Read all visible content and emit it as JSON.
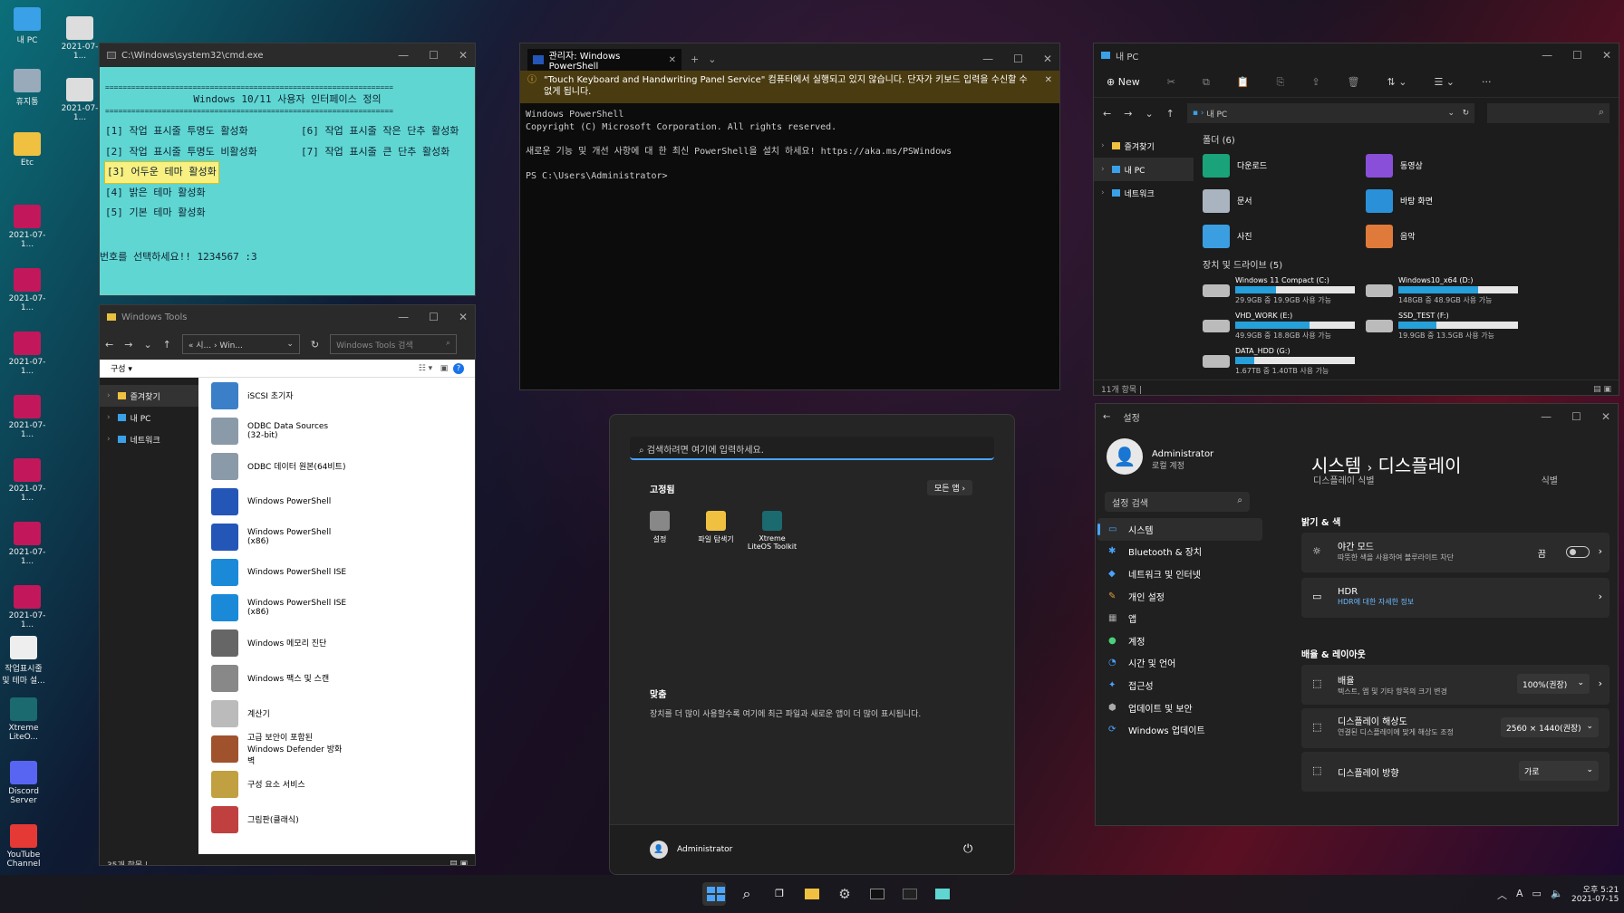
{
  "desktop": {
    "icons": [
      {
        "label": "내 PC",
        "color": "#3aa0e8"
      },
      {
        "label": "2021-07-1...",
        "color": "#ddd"
      },
      {
        "label": "휴지통",
        "color": "#9ab"
      },
      {
        "label": "2021-07-1...",
        "color": "#ddd"
      },
      {
        "label": "Etc",
        "color": "#f0c040"
      },
      {
        "label": "2021-07-1...",
        "color": "#c2185b"
      },
      {
        "label": "2021-07-1...",
        "color": "#c2185b"
      },
      {
        "label": "2021-07-1...",
        "color": "#c2185b"
      },
      {
        "label": "2021-07-1...",
        "color": "#c2185b"
      },
      {
        "label": "2021-07-1...",
        "color": "#c2185b"
      },
      {
        "label": "2021-07-1...",
        "color": "#c2185b"
      },
      {
        "label": "2021-07-1...",
        "color": "#c2185b"
      },
      {
        "label": "작업표시줄 및 테마 설...",
        "color": "#eee"
      },
      {
        "label": "Xtreme LiteO...",
        "color": "#1a6a70"
      },
      {
        "label": "Discord Server",
        "color": "#5865f2"
      },
      {
        "label": "YouTube Channel",
        "color": "#e53935"
      }
    ]
  },
  "cmd": {
    "title": "C:\\Windows\\system32\\cmd.exe",
    "rule": "==================================================================",
    "heading": "Windows 10/11 사용자 인터페이스 정의",
    "left": [
      "[1] 작업 표시줄 투명도 활성화",
      "[2] 작업 표시줄 투명도 비활성화",
      "[3] 어두운 테마 활성화",
      "[4] 밝은 테마 활성화",
      "[5] 기본 테마 활성화"
    ],
    "right": [
      "[6] 작업 표시줄 작은 단추 활성화",
      "[7] 작업 표시줄 큰 단추 활성화"
    ],
    "prompt": "번호를 선택하세요!! 1234567 :3"
  },
  "tools": {
    "title": "Windows Tools",
    "path": "« 시... › Win...",
    "search": "Windows Tools 검색",
    "menu": "구성 ▾",
    "nav": [
      "즐겨찾기",
      "내 PC",
      "네트워크"
    ],
    "items": [
      "iSCSI 초기자",
      "ODBC Data Sources (32-bit)",
      "ODBC 데이터 원본(64비트)",
      "Windows PowerShell",
      "Windows PowerShell (x86)",
      "Windows PowerShell ISE",
      "Windows PowerShell ISE (x86)",
      "Windows 메모리 진단",
      "Windows 팩스 및 스캔",
      "계산기",
      "고급 보안이 포함된 Windows Defender 방화벽",
      "구성 요소 서비스",
      "그림판(클래식)"
    ],
    "status": "35개 항목  |"
  },
  "ps": {
    "tab": "관리자: Windows PowerShell",
    "warn": "\"Touch Keyboard and Handwriting Panel Service\" 컴퓨터에서 실행되고 있지 않습니다. 단자가 키보드 입력을 수신할 수 없게 됩니다.",
    "lines": [
      "Windows PowerShell",
      "Copyright (C) Microsoft Corporation. All rights reserved.",
      "",
      "새로운 기능 및 개선 사항에 대 한 최신 PowerShell을 설치 하세요! https://aka.ms/PSWindows",
      "",
      "PS C:\\Users\\Administrator>"
    ]
  },
  "explorer": {
    "title": "내 PC",
    "new": "New",
    "address": "내 PC",
    "nav": [
      "즐겨찾기",
      "내 PC",
      "네트워크"
    ],
    "folders_header": "폴더 (6)",
    "folders": [
      {
        "name": "다운로드",
        "color": "#1aa37a"
      },
      {
        "name": "동영상",
        "color": "#8a4fd8"
      },
      {
        "name": "문서",
        "color": "#aab4c0"
      },
      {
        "name": "바탕 화면",
        "color": "#2a90d8"
      },
      {
        "name": "사진",
        "color": "#3a9ee0"
      },
      {
        "name": "음악",
        "color": "#e07a3a"
      }
    ],
    "drives_header": "장치 및 드라이브 (5)",
    "drives": [
      {
        "name": "Windows 11 Compact (C:)",
        "free": "29.9GB 중 19.9GB 사용 가능",
        "used": 0.34
      },
      {
        "name": "Windows10_x64 (D:)",
        "free": "148GB 중 48.9GB 사용 가능",
        "used": 0.67
      },
      {
        "name": "VHD_WORK (E:)",
        "free": "49.9GB 중 18.8GB 사용 가능",
        "used": 0.62
      },
      {
        "name": "SSD_TEST (F:)",
        "free": "19.9GB 중 13.5GB 사용 가능",
        "used": 0.32
      },
      {
        "name": "DATA_HDD (G:)",
        "free": "1.67TB 중 1.40TB 사용 가능",
        "used": 0.16
      }
    ],
    "status": "11개 항목  |"
  },
  "settings": {
    "title": "설정",
    "user": "Administrator",
    "account": "로컬 계정",
    "search": "설정 검색",
    "crumb1": "시스템",
    "crumb2": "디스플레이",
    "partial_left": "디스플레이 식별",
    "partial_right": "식별",
    "nav": [
      "시스템",
      "Bluetooth & 장치",
      "네트워크 및 인터넷",
      "개인 설정",
      "앱",
      "계정",
      "시간 및 언어",
      "접근성",
      "업데이트 및 보안",
      "Windows 업데이트"
    ],
    "sec1": "밝기 & 색",
    "night": "야간 모드",
    "night_sub": "따뜻한 색을 사용하여 블루라이트 차단",
    "night_state": "끔",
    "hdr": "HDR",
    "hdr_sub": "HDR에 대한 자세한 정보",
    "sec2": "배율 & 레이아웃",
    "scale": "배율",
    "scale_sub": "텍스트, 앱 및 기타 항목의 크기 변경",
    "scale_val": "100%(권장)",
    "res": "디스플레이 해상도",
    "res_sub": "연결된 디스플레이에 맞게 해상도 조정",
    "res_val": "2560 × 1440(권장)",
    "orient": "디스플레이 방향",
    "orient_val": "가로"
  },
  "start": {
    "search": "검색하려면 여기에 입력하세요.",
    "pinned": "고정됨",
    "all": "모든 앱  ›",
    "apps": [
      "설정",
      "파일 탐색기",
      "Xtreme LiteOS Toolkit"
    ],
    "rec": "맞춤",
    "rec_sub": "장치를 더 많이 사용할수록 여기에 최근 파일과 새로운 앱이 더 많이 표시됩니다.",
    "user": "Administrator"
  },
  "taskbar": {
    "time": "오후 5:21",
    "date": "2021-07-15",
    "ime": "A"
  }
}
